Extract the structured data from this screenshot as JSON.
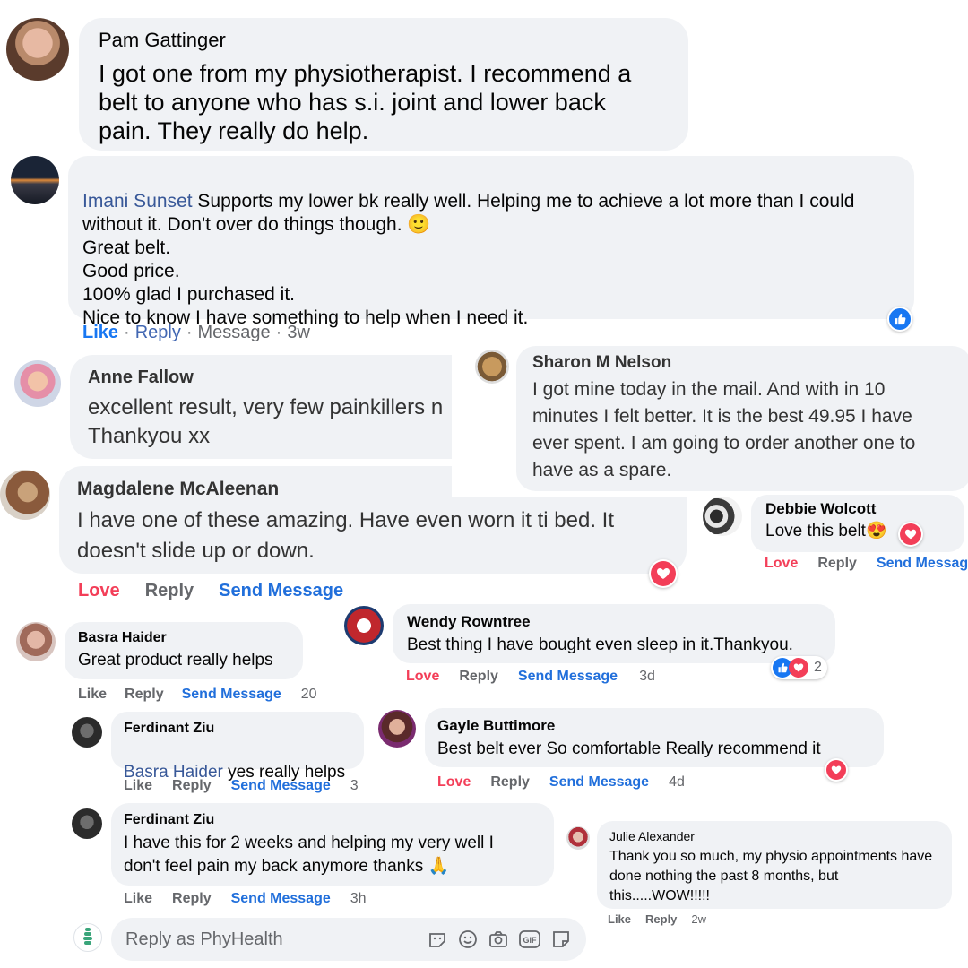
{
  "comments": {
    "pam": {
      "name": "Pam Gattinger",
      "text": "I got one from my physiotherapist. I recommend a\nbelt to anyone who has s.i. joint and lower back\npain. They really do help."
    },
    "imani": {
      "name": "Imani Sunset",
      "text_first": " Supports my lower bk really well. Helping me to achieve a lot more than I could",
      "text_rest": "without it. Don't over do things though. 🙂\nGreat belt.\nGood price.\n100% glad I purchased it.\nNice to know I have something to help when I need it.",
      "like": "Like",
      "reply": "Reply",
      "message": "Message",
      "time": "3w"
    },
    "anne": {
      "name": "Anne Fallow",
      "text": "excellent result, very few painkillers n\nThankyou xx"
    },
    "sharon": {
      "name": "Sharon M Nelson",
      "text": "I got mine today in the mail. And with in 10\nminutes I felt better. It is the best 49.95 I have\never spent. I am going to order another one to\nhave as a spare."
    },
    "magdalene": {
      "name": "Magdalene McAleenan",
      "text": "I have one of these amazing. Have even worn it ti bed. It\ndoesn't slide up or down.",
      "love": "Love",
      "reply": "Reply",
      "message": "Send Message"
    },
    "debbie": {
      "name": "Debbie Wolcott",
      "text": "Love this belt😍",
      "love": "Love",
      "reply": "Reply",
      "message": "Send Messag"
    },
    "wendy": {
      "name": "Wendy Rowntree",
      "text": "Best thing I have bought even sleep in it.Thankyou.",
      "love": "Love",
      "reply": "Reply",
      "message": "Send Message",
      "time": "3d",
      "reaction_count": "2"
    },
    "basra": {
      "name": "Basra Haider",
      "text": "Great product really helps",
      "like": "Like",
      "reply": "Reply",
      "message": "Send Message",
      "time": "20"
    },
    "ferdinant1": {
      "name": "Ferdinant Ziu",
      "mention": "Basra Haider",
      "text": " yes really helps",
      "like": "Like",
      "reply": "Reply",
      "message": "Send Message",
      "time": "3"
    },
    "gayle": {
      "name": "Gayle Buttimore",
      "text": "Best belt ever So comfortable Really recommend it",
      "love": "Love",
      "reply": "Reply",
      "message": "Send Message",
      "time": "4d"
    },
    "ferdinant2": {
      "name": "Ferdinant Ziu",
      "text": "I have this for 2 weeks and helping my very well I\ndon't feel pain my back anymore thanks 🙏",
      "like": "Like",
      "reply": "Reply",
      "message": "Send Message",
      "time": "3h"
    },
    "julie": {
      "name": "Julie Alexander",
      "text": "Thank you so much, my physio appointments have\ndone nothing the past 8 months, but\nthis.....WOW!!!!!",
      "like": "Like",
      "reply": "Reply",
      "time": "2w"
    }
  },
  "composer": {
    "placeholder": "Reply as PhyHealth"
  },
  "icons": [
    "emoji-icon",
    "camera-icon",
    "gif-icon",
    "sticker-icon",
    "like-icon",
    "heart-icon"
  ],
  "colors": {
    "bubble": "#f0f2f5",
    "link": "#216fdb",
    "love": "#f33e58",
    "like": "#1877f2",
    "meta": "#65676b"
  }
}
